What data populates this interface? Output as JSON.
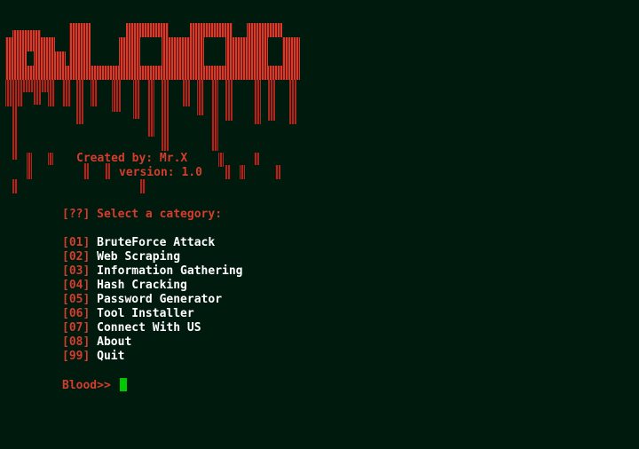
{
  "terminal": {
    "created_by": "Created by: Mr.X",
    "version": "version: 1.0",
    "select_tag": "[??]",
    "select_text": "Select a category:",
    "menu": [
      {
        "code": "[01]",
        "label": "BruteForce Attack"
      },
      {
        "code": "[02]",
        "label": "Web Scraping"
      },
      {
        "code": "[03]",
        "label": "Information Gathering"
      },
      {
        "code": "[04]",
        "label": "Hash Cracking"
      },
      {
        "code": "[05]",
        "label": "Password Generator"
      },
      {
        "code": "[06]",
        "label": "Tool Installer"
      },
      {
        "code": "[07]",
        "label": "Connect With US"
      },
      {
        "code": "[08]",
        "label": "About"
      },
      {
        "code": "[99]",
        "label": "Quit"
      }
    ],
    "prompt": "Blood>>"
  },
  "colors": {
    "background": "#001a0e",
    "accent_red": "#d63c2c",
    "text_white": "#ffffff",
    "cursor_green": "#00c800"
  }
}
